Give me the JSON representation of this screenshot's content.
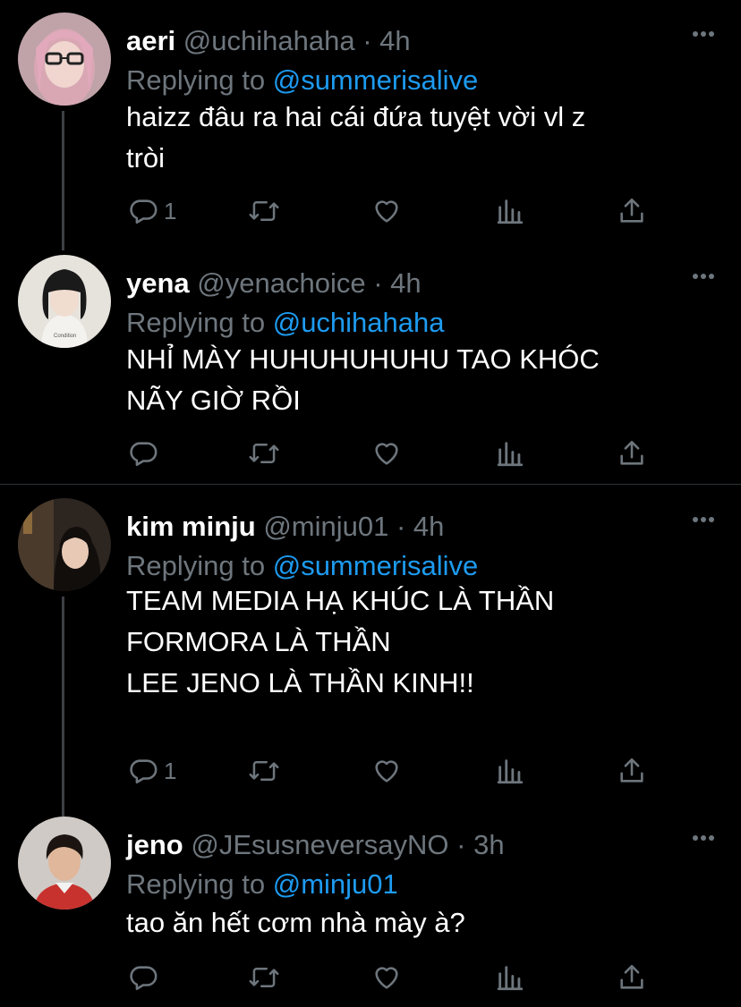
{
  "tweets": [
    {
      "name": "aeri",
      "handle": "@uchihahaha",
      "time": "· 4h",
      "replying_prefix": "Replying to",
      "replying_to": "@summerisalive",
      "text": "haizz đâu ra hai cái đứa tuyệt vời vl z\ntròi",
      "reply_count": "1",
      "avatar_color": "#c9a0a6"
    },
    {
      "name": "yena",
      "handle": "@yenachoice",
      "time": "· 4h",
      "replying_prefix": "Replying to",
      "replying_to": "@uchihahaha",
      "text": "NHỈ MÀY HUHUHUHUHU TAO KHÓC\nNÃY GIỜ RỒI",
      "reply_count": "",
      "avatar_color": "#d8d4cf"
    },
    {
      "name": "kim minju",
      "handle": "@minju01",
      "time": "· 4h",
      "replying_prefix": "Replying to",
      "replying_to": "@summerisalive",
      "text": "TEAM MEDIA HẠ KHÚC LÀ THẦN\nFORMORA LÀ THẦN\nLEE JENO LÀ THẦN KINH!!",
      "reply_count": "1",
      "avatar_color": "#3a2e28"
    },
    {
      "name": "jeno",
      "handle": "@JEsusneversayNO",
      "time": "· 3h",
      "replying_prefix": "Replying to",
      "replying_to": "@minju01",
      "text": "tao ăn hết cơm nhà mày à?",
      "reply_count": "",
      "avatar_color": "#c7c3c0"
    }
  ],
  "colors": {
    "background": "#000000",
    "muted": "#6e767d",
    "link": "#1d9bf0",
    "divider": "#2f3336"
  }
}
